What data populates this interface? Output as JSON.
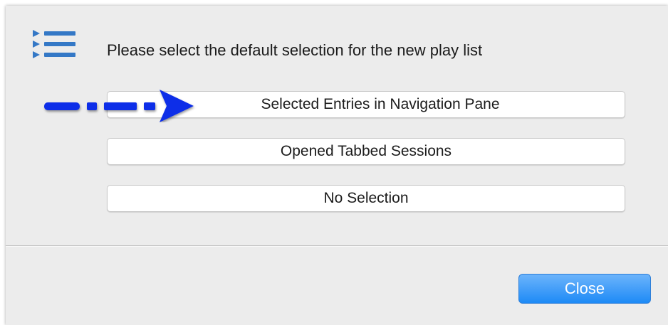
{
  "dialog": {
    "prompt": "Please select the default selection for the new play list",
    "header_icon": "playlist-icon",
    "options": [
      {
        "label": "Selected Entries in Navigation Pane",
        "highlighted": true
      },
      {
        "label": "Opened Tabbed Sessions"
      },
      {
        "label": "No Selection"
      }
    ],
    "pointer_icon": "dashed-arrow-icon",
    "close_label": "Close"
  },
  "colors": {
    "accent": "#1d8af6",
    "icon_blue": "#3478c6",
    "arrow_blue": "#0a2ee8",
    "dialog_bg": "#ececec"
  }
}
